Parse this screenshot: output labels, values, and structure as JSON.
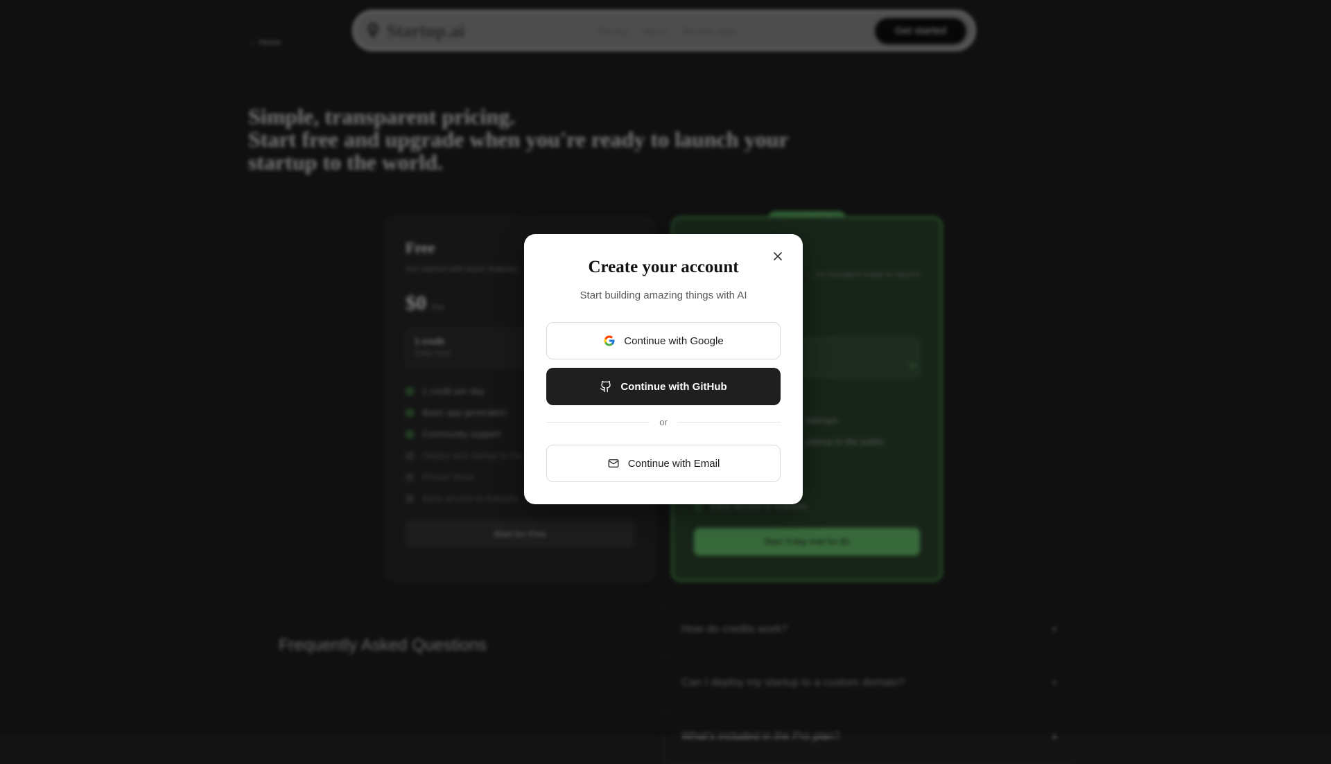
{
  "nav": {
    "brand": "Startup.ai",
    "links": [
      "Pricing",
      "About",
      "Browse ideas"
    ],
    "cta": "Get started"
  },
  "back_link": "← Home",
  "hero": {
    "line1": "Simple, transparent pricing.",
    "line2": "Start free and upgrade when you're ready to launch your",
    "line3": "startup to the world."
  },
  "plans": {
    "free": {
      "name": "Free",
      "description": "Get started with basic features",
      "price": "$0",
      "period": "/mo",
      "credits_title": "1 credit",
      "credits_sub": "Daily reset",
      "features": [
        {
          "text": "1 credit per day",
          "included": true
        },
        {
          "text": "Basic app generation",
          "included": true
        },
        {
          "text": "Community support",
          "included": true
        },
        {
          "text": "Deploy and startup to the public",
          "included": false
        },
        {
          "text": "Private ideas",
          "included": false
        },
        {
          "text": "Early access to features",
          "included": false
        }
      ],
      "button": "Start for Free"
    },
    "pro": {
      "badge": "MOST POPULAR",
      "description": "...for founders ready to launch",
      "features": [
        {
          "text": "...startups",
          "included": true
        },
        {
          "text": "...startup to the public",
          "included": true
        },
        {
          "text": "Early access to features",
          "included": true
        }
      ],
      "button": "Start 3-day trial for $1"
    }
  },
  "faq": {
    "title": "Frequently Asked Questions",
    "items": [
      "How do credits work?",
      "Can I deploy my startup to a custom domain?",
      "What's included in the Pro plan?"
    ]
  },
  "modal": {
    "title": "Create your account",
    "subtitle": "Start building amazing things with AI",
    "google_label": "Continue with Google",
    "github_label": "Continue with GitHub",
    "divider_text": "or",
    "email_label": "Continue with Email",
    "close_icon": "close-icon"
  },
  "colors": {
    "page_bg": "#141414",
    "accent_green": "#57a85c",
    "modal_bg": "#ffffff",
    "github_button_bg": "#1f1f1f"
  }
}
